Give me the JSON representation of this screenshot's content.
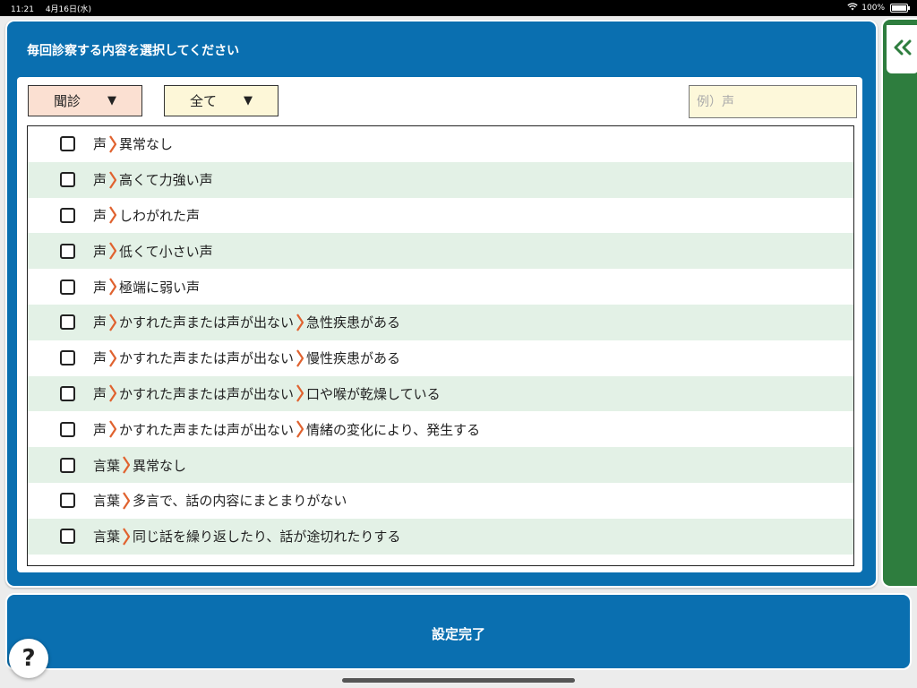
{
  "status_bar": {
    "time": "11:21",
    "date": "4月16日(水)",
    "battery": "100%"
  },
  "main": {
    "title": "毎回診察する内容を選択してください",
    "filter_category": "聞診",
    "filter_scope": "全て",
    "search_placeholder": "例）声"
  },
  "items": [
    {
      "parts": [
        "声",
        "異常なし"
      ],
      "checked": false
    },
    {
      "parts": [
        "声",
        "高くて力強い声"
      ],
      "checked": false
    },
    {
      "parts": [
        "声",
        "しわがれた声"
      ],
      "checked": false
    },
    {
      "parts": [
        "声",
        "低くて小さい声"
      ],
      "checked": false
    },
    {
      "parts": [
        "声",
        "極端に弱い声"
      ],
      "checked": false
    },
    {
      "parts": [
        "声",
        "かすれた声または声が出ない",
        "急性疾患がある"
      ],
      "checked": false
    },
    {
      "parts": [
        "声",
        "かすれた声または声が出ない",
        "慢性疾患がある"
      ],
      "checked": false
    },
    {
      "parts": [
        "声",
        "かすれた声または声が出ない",
        "口や喉が乾燥している"
      ],
      "checked": false
    },
    {
      "parts": [
        "声",
        "かすれた声または声が出ない",
        "情緒の変化により、発生する"
      ],
      "checked": false
    },
    {
      "parts": [
        "言葉",
        "異常なし"
      ],
      "checked": false
    },
    {
      "parts": [
        "言葉",
        "多言で、話の内容にまとまりがない"
      ],
      "checked": false
    },
    {
      "parts": [
        "言葉",
        "同じ話を繰り返したり、話が途切れたりする"
      ],
      "checked": false
    }
  ],
  "footer": {
    "done_label": "設定完了"
  },
  "help": {
    "label": "?"
  },
  "colors": {
    "primary_blue": "#0a6fb0",
    "side_green": "#2e7d3e",
    "row_alt": "#e3f1e6",
    "chevron": "#e0622f",
    "filter_category_bg": "#fbe0d2",
    "filter_scope_bg": "#fdf7d8"
  }
}
